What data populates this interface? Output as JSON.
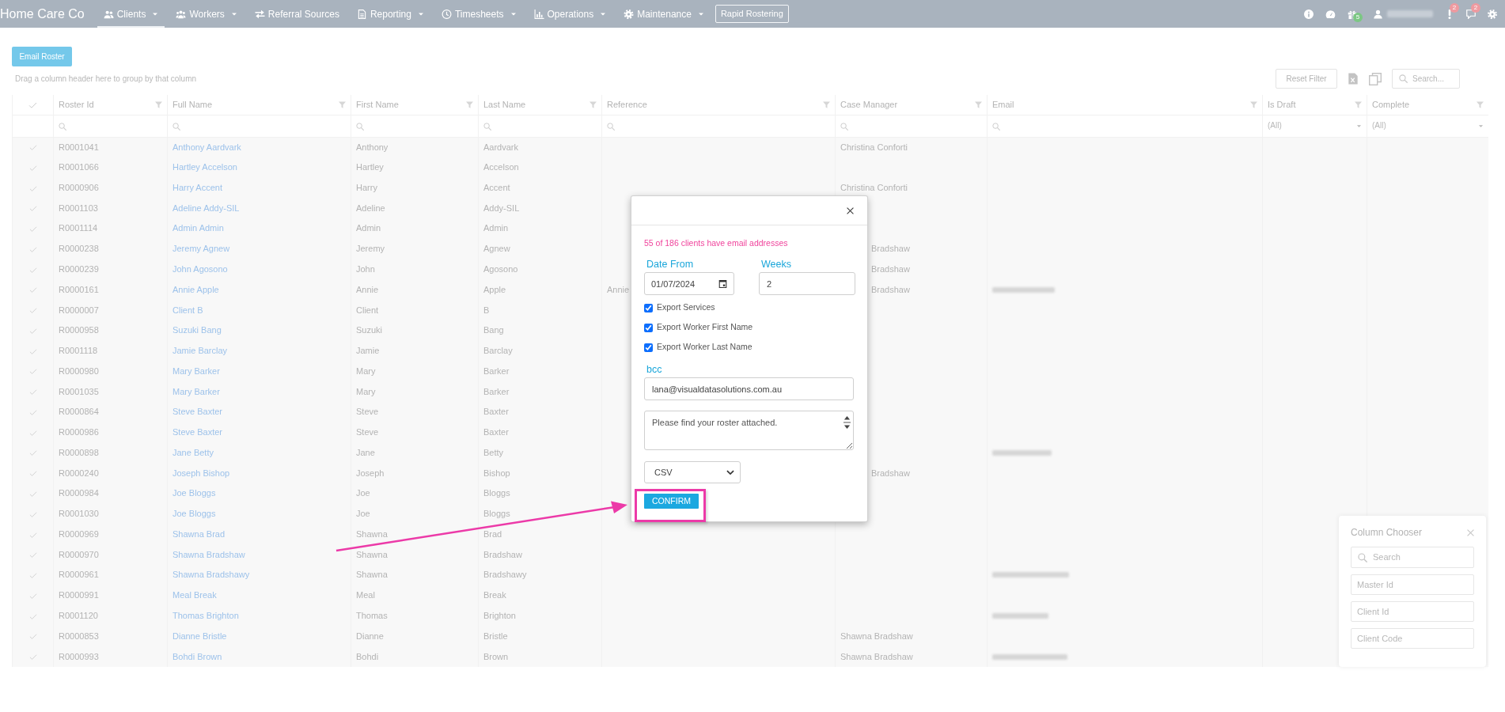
{
  "navbar": {
    "brand": "Home Care Co",
    "menu": [
      {
        "label": "Clients",
        "selected": true,
        "dropdown": true
      },
      {
        "label": "Workers",
        "selected": false,
        "dropdown": true
      },
      {
        "label": "Referral Sources",
        "selected": false,
        "dropdown": false
      },
      {
        "label": "Reporting",
        "selected": false,
        "dropdown": true
      },
      {
        "label": "Timesheets",
        "selected": false,
        "dropdown": true
      },
      {
        "label": "Operations",
        "selected": false,
        "dropdown": true
      },
      {
        "label": "Maintenance",
        "selected": false,
        "dropdown": true
      }
    ],
    "rapid_button": "Rapid Rostering",
    "user_name_blurred": true,
    "alerts": [
      {
        "badge": "5",
        "color": "#7cc784"
      },
      {
        "badge": "2",
        "color": "#ee9aa0"
      },
      {
        "badge": "2",
        "color": "#ee9aa0"
      }
    ]
  },
  "toolbar": {
    "email_button": "Email Roster",
    "group_hint": "Drag a column header here to group by that column",
    "reset_button": "Reset Filter",
    "search": {
      "placeholder": "Search..."
    }
  },
  "grid": {
    "select_all_checked": true,
    "columns": [
      {
        "label": "Roster Id",
        "filter": {
          "kind": "search"
        }
      },
      {
        "label": "Full Name",
        "filter": {
          "kind": "search"
        }
      },
      {
        "label": "First Name",
        "filter": {
          "kind": "search"
        }
      },
      {
        "label": "Last Name",
        "filter": {
          "kind": "search"
        }
      },
      {
        "label": "Reference",
        "filter": {
          "kind": "search"
        }
      },
      {
        "label": "Case Manager",
        "filter": {
          "kind": "search"
        }
      },
      {
        "label": "Email",
        "filter": {
          "kind": "search"
        }
      },
      {
        "label": "Is Draft",
        "filter": {
          "kind": "select",
          "value": "(All)"
        }
      },
      {
        "label": "Complete",
        "filter": {
          "kind": "select",
          "value": "(All)"
        }
      }
    ],
    "rows": [
      {
        "checked": true,
        "roster_id": "R0001041",
        "full_name": "Anthony Aardvark",
        "first_name": "Anthony",
        "last_name": "Aardvark",
        "case_manager": "Christina Conforti",
        "email_blurred": false
      },
      {
        "checked": true,
        "roster_id": "R0001066",
        "full_name": "Hartley Accelson",
        "first_name": "Hartley",
        "last_name": "Accelson",
        "email_blurred": false
      },
      {
        "checked": true,
        "roster_id": "R0000906",
        "full_name": "Harry Accent",
        "first_name": "Harry",
        "last_name": "Accent",
        "case_manager": "Christina Conforti",
        "email_blurred": false
      },
      {
        "checked": true,
        "roster_id": "R0001103",
        "full_name": "Adeline Addy-SIL",
        "first_name": "Adeline",
        "last_name": "Addy-SIL",
        "email_blurred": false
      },
      {
        "checked": true,
        "roster_id": "R0001114",
        "full_name": "Admin Admin",
        "first_name": "Admin",
        "last_name": "Admin",
        "email_blurred": false
      },
      {
        "checked": true,
        "roster_id": "R0000238",
        "full_name": "Jeremy Agnew",
        "first_name": "Jeremy",
        "last_name": "Agnew",
        "case_manager": "Bradshaw",
        "email_blurred": false
      },
      {
        "checked": true,
        "roster_id": "R0000239",
        "full_name": "John Agosono",
        "first_name": "John",
        "last_name": "Agosono",
        "case_manager": "Bradshaw",
        "email_blurred": false
      },
      {
        "checked": true,
        "roster_id": "R0000161",
        "full_name": "Annie Apple",
        "first_name": "Annie",
        "last_name": "Apple",
        "reference": "Annie",
        "case_manager": "Bradshaw",
        "email_blurred": true
      },
      {
        "checked": true,
        "roster_id": "R0000007",
        "full_name": "Client B",
        "first_name": "Client",
        "last_name": "B",
        "email_blurred": false
      },
      {
        "checked": true,
        "roster_id": "R0000958",
        "full_name": "Suzuki Bang",
        "first_name": "Suzuki",
        "last_name": "Bang",
        "email_blurred": false
      },
      {
        "checked": true,
        "roster_id": "R0001118",
        "full_name": "Jamie Barclay",
        "first_name": "Jamie",
        "last_name": "Barclay",
        "email_blurred": false
      },
      {
        "checked": true,
        "roster_id": "R0000980",
        "full_name": "Mary Barker",
        "first_name": "Mary",
        "last_name": "Barker",
        "email_blurred": false
      },
      {
        "checked": true,
        "roster_id": "R0001035",
        "full_name": "Mary Barker",
        "first_name": "Mary",
        "last_name": "Barker",
        "email_blurred": false
      },
      {
        "checked": true,
        "roster_id": "R0000864",
        "full_name": "Steve Baxter",
        "first_name": "Steve",
        "last_name": "Baxter",
        "email_blurred": false
      },
      {
        "checked": true,
        "roster_id": "R0000986",
        "full_name": "Steve Baxter",
        "first_name": "Steve",
        "last_name": "Baxter",
        "email_blurred": false
      },
      {
        "checked": true,
        "roster_id": "R0000898",
        "full_name": "Jane Betty",
        "first_name": "Jane",
        "last_name": "Betty",
        "email_blurred": true
      },
      {
        "checked": true,
        "roster_id": "R0000240",
        "full_name": "Joseph Bishop",
        "first_name": "Joseph",
        "last_name": "Bishop",
        "case_manager": "Bradshaw",
        "email_blurred": false
      },
      {
        "checked": true,
        "roster_id": "R0000984",
        "full_name": "Joe Bloggs",
        "first_name": "Joe",
        "last_name": "Bloggs",
        "email_blurred": false
      },
      {
        "checked": true,
        "roster_id": "R0001030",
        "full_name": "Joe Bloggs",
        "first_name": "Joe",
        "last_name": "Bloggs",
        "email_blurred": false
      },
      {
        "checked": true,
        "roster_id": "R0000969",
        "full_name": "Shawna Brad",
        "first_name": "Shawna",
        "last_name": "Brad",
        "email_blurred": false
      },
      {
        "checked": true,
        "roster_id": "R0000970",
        "full_name": "Shawna Bradshaw",
        "first_name": "Shawna",
        "last_name": "Bradshaw",
        "email_blurred": false
      },
      {
        "checked": true,
        "roster_id": "R0000961",
        "full_name": "Shawna Bradshawy",
        "first_name": "Shawna",
        "last_name": "Bradshawy",
        "email_blurred": true
      },
      {
        "checked": true,
        "roster_id": "R0000991",
        "full_name": "Meal Break",
        "first_name": "Meal",
        "last_name": "Break",
        "email_blurred": false
      },
      {
        "checked": true,
        "roster_id": "R0001120",
        "full_name": "Thomas Brighton",
        "first_name": "Thomas",
        "last_name": "Brighton",
        "email_blurred": true
      },
      {
        "checked": true,
        "roster_id": "R0000853",
        "full_name": "Dianne Bristle",
        "first_name": "Dianne",
        "last_name": "Bristle",
        "case_manager": "Shawna Bradshaw",
        "email_blurred": false
      },
      {
        "checked": true,
        "roster_id": "R0000993",
        "full_name": "Bohdi Brown",
        "first_name": "Bohdi",
        "last_name": "Brown",
        "case_manager": "Shawna Bradshaw",
        "email_blurred": true
      }
    ]
  },
  "dialog": {
    "note": "55 of 186 clients have email addresses",
    "date_from": {
      "label": "Date From",
      "value": "01/07/2024"
    },
    "weeks": {
      "label": "Weeks",
      "value": "2"
    },
    "options": [
      {
        "label": "Export Services",
        "checked": true
      },
      {
        "label": "Export Worker First Name",
        "checked": true
      },
      {
        "label": "Export Worker Last Name",
        "checked": true
      }
    ],
    "bcc": {
      "label": "bcc",
      "value": "lana@visualdatasolutions.com.au"
    },
    "message": {
      "value": "Please find your roster attached."
    },
    "format": {
      "value": "CSV"
    },
    "confirm_button": "CONFIRM"
  },
  "column_chooser": {
    "title": "Column Chooser",
    "search_placeholder": "Search",
    "items": [
      "Master Id",
      "Client Id",
      "Client Code"
    ]
  },
  "annotations": {
    "highlight_frame": true,
    "pointer_arrow": true
  }
}
